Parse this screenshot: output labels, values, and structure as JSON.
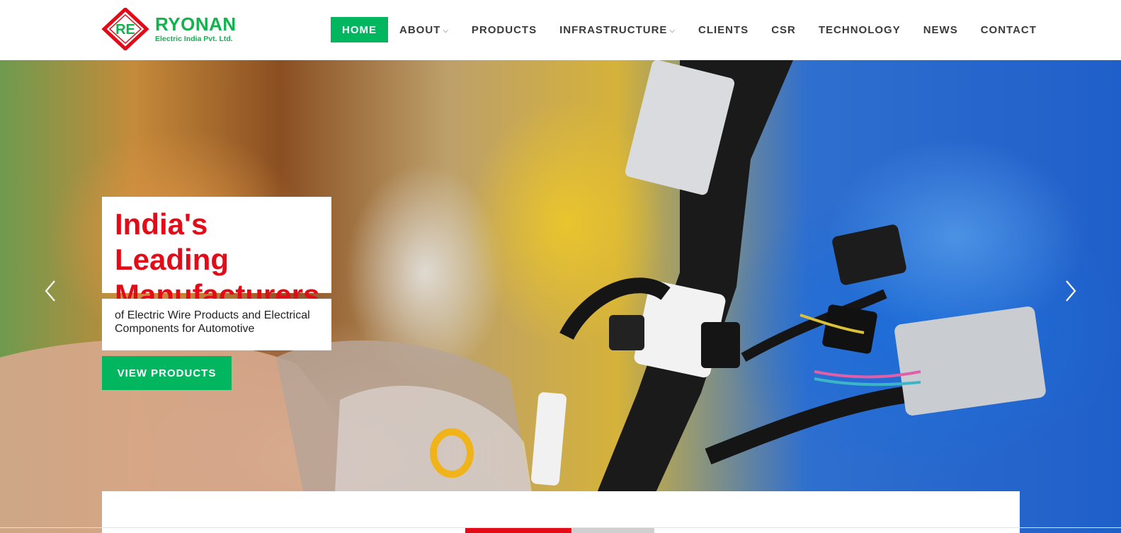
{
  "brand": {
    "mark": "RE",
    "name": "RYONAN",
    "tagline": "Electric India Pvt. Ltd.",
    "colors": {
      "green": "#12b24f",
      "red": "#e30b17"
    }
  },
  "nav": {
    "items": [
      {
        "label": "HOME",
        "active": true
      },
      {
        "label": "ABOUT",
        "dropdown": true
      },
      {
        "label": "PRODUCTS"
      },
      {
        "label": "INFRASTRUCTURE",
        "dropdown": true
      },
      {
        "label": "CLIENTS"
      },
      {
        "label": "CSR"
      },
      {
        "label": "TECHNOLOGY"
      },
      {
        "label": "NEWS"
      },
      {
        "label": "CONTACT"
      }
    ],
    "caret": "⌵"
  },
  "hero": {
    "title_line1": "India's Leading",
    "title_line2": "Manufacturers",
    "subtitle": "of Electric Wire Products and Electrical Components for Automotive",
    "cta": "VIEW PRODUCTS",
    "prev_icon": "chevron-left-icon",
    "next_icon": "chevron-right-icon"
  },
  "theme": {
    "accent": "#02b660",
    "headline": "#e30b17"
  }
}
